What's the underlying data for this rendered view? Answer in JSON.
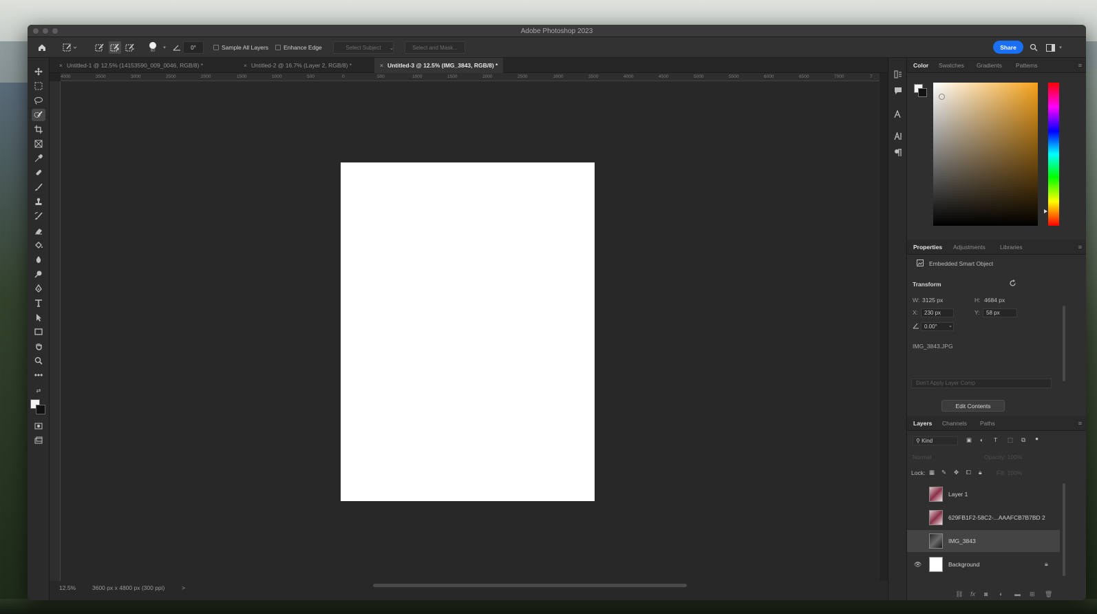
{
  "app": {
    "title": "Adobe Photoshop 2023"
  },
  "options_bar": {
    "brush_size": "60",
    "angle": "0°",
    "sample_all_layers": "Sample All Layers",
    "enhance_edge": "Enhance Edge",
    "select_subject": "Select Subject",
    "select_and_mask": "Select and Mask...",
    "share": "Share"
  },
  "tabs": [
    {
      "label": "Untitled-1 @ 12.5% (14153590_009_0046, RGB/8) *"
    },
    {
      "label": "Untitled-2 @ 16.7% (Layer 2, RGB/8) *"
    },
    {
      "label": "Untitled-3 @ 12.5% (IMG_3843, RGB/8) *"
    }
  ],
  "ruler": {
    "ticks": [
      "4000",
      "3500",
      "3000",
      "2500",
      "2000",
      "1500",
      "1000",
      "500",
      "0",
      "500",
      "1000",
      "1500",
      "2000",
      "2500",
      "3000",
      "3500",
      "4000",
      "4500",
      "5000",
      "5500",
      "6000",
      "6500",
      "7000",
      "7"
    ]
  },
  "status": {
    "zoom": "12.5%",
    "doc_info": "3600 px x 4800 px (300 ppi)",
    "arrow": ">"
  },
  "color_panel": {
    "tabs": [
      "Color",
      "Swatches",
      "Gradients",
      "Patterns"
    ],
    "hue_position": 0.9
  },
  "properties_panel": {
    "tabs": [
      "Properties",
      "Adjustments",
      "Libraries"
    ],
    "object_type": "Embedded Smart Object",
    "transform_label": "Transform",
    "w_label": "W:",
    "w_value": "3125 px",
    "h_label": "H:",
    "h_value": "4684 px",
    "x_label": "X:",
    "x_value": "230 px",
    "y_label": "Y:",
    "y_value": "58 px",
    "angle_value": "0.00°",
    "filename": "IMG_3843.JPG",
    "layer_comp": "Don't Apply Layer Comp",
    "edit_contents": "Edit Contents"
  },
  "layers_panel": {
    "tabs": [
      "Layers",
      "Channels",
      "Paths"
    ],
    "kind_filter": "Kind",
    "blend_mode": "Normal",
    "opacity": "Opacity: 100%",
    "lock_label": "Lock:",
    "fill": "Fill: 100%",
    "layers": [
      {
        "name": "Layer 1"
      },
      {
        "name": "629FB1F2-58C2-...AAAFCB7B7BD 2"
      },
      {
        "name": "IMG_3843"
      },
      {
        "name": "Background"
      }
    ]
  }
}
